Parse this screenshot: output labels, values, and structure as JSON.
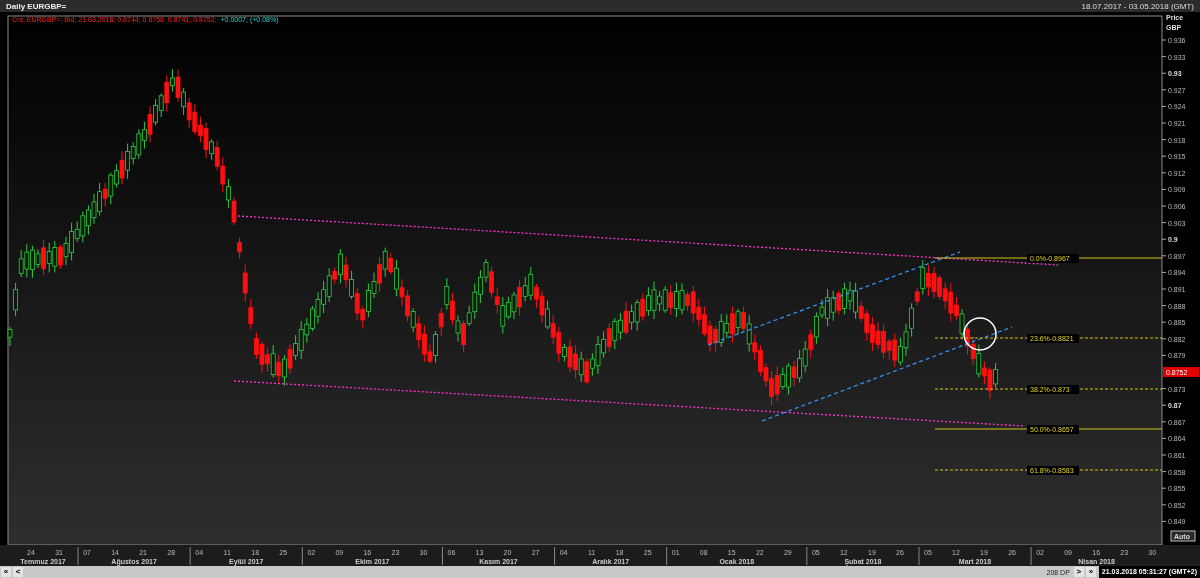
{
  "window": {
    "title": "Daily EURGBP=",
    "date_range": "18.07.2017 - 03.05.2018 (GMT)"
  },
  "quote": {
    "instrument": "Cnt; EURGBP=; Bid; 21.03.2018; 0.8744; 0.8758; 0.8741; 0.8752;",
    "change": "+0.0007; (+0.08%)"
  },
  "price_axis": {
    "title": "Price",
    "currency": "GBP",
    "ticks_upper": [
      {
        "label": "0.936",
        "bold": false
      },
      {
        "label": "0.933",
        "bold": false
      },
      {
        "label": "0.93",
        "bold": true
      },
      {
        "label": "0.927",
        "bold": false
      },
      {
        "label": "0.924",
        "bold": false
      },
      {
        "label": "0.921",
        "bold": false
      },
      {
        "label": "0.918",
        "bold": false
      },
      {
        "label": "0.915",
        "bold": false
      },
      {
        "label": "0.912",
        "bold": false
      },
      {
        "label": "0.909",
        "bold": false
      },
      {
        "label": "0.906",
        "bold": false
      },
      {
        "label": "0.903",
        "bold": false
      },
      {
        "label": "0.9",
        "bold": true
      },
      {
        "label": "0.897",
        "bold": false
      },
      {
        "label": "0.894",
        "bold": false
      },
      {
        "label": "0.891",
        "bold": false
      },
      {
        "label": "0.888",
        "bold": false
      },
      {
        "label": "0.885",
        "bold": false
      },
      {
        "label": "0.882",
        "bold": false
      },
      {
        "label": "0.879",
        "bold": false
      }
    ],
    "ticks_lower": [
      {
        "label": "0.873",
        "bold": false
      },
      {
        "label": "0.87",
        "bold": true
      },
      {
        "label": "0.867",
        "bold": false
      },
      {
        "label": "0.864",
        "bold": false
      },
      {
        "label": "0.861",
        "bold": false
      },
      {
        "label": "0.858",
        "bold": false
      },
      {
        "label": "0.855",
        "bold": false
      },
      {
        "label": "0.852",
        "bold": false
      },
      {
        "label": "0.849",
        "bold": false
      }
    ],
    "current_price": "0.8752",
    "auto_button": "Auto"
  },
  "fibonacci": [
    {
      "label": "0.0%-0.8967",
      "kind": "solid"
    },
    {
      "label": "23.6%-0.8821",
      "kind": "dashed"
    },
    {
      "label": "38.2%-0.873",
      "kind": "dashed"
    },
    {
      "label": "50.0%-0.8657",
      "kind": "solid"
    },
    {
      "label": "61.8%-0.8583",
      "kind": "dashed"
    }
  ],
  "time_axis": {
    "months": [
      {
        "label": "Temmuz 2017",
        "days": [
          "24",
          "31"
        ]
      },
      {
        "label": "Ağustos 2017",
        "days": [
          "07",
          "14",
          "21",
          "28"
        ]
      },
      {
        "label": "Eylül 2017",
        "days": [
          "04",
          "11",
          "18",
          "25"
        ]
      },
      {
        "label": "Ekim 2017",
        "days": [
          "02",
          "09",
          "16",
          "23",
          "30"
        ]
      },
      {
        "label": "Kasım 2017",
        "days": [
          "06",
          "13",
          "20",
          "27"
        ]
      },
      {
        "label": "Aralık 2017",
        "days": [
          "04",
          "11",
          "18",
          "25"
        ]
      },
      {
        "label": "Ocak 2018",
        "days": [
          "01",
          "08",
          "15",
          "22",
          "29"
        ]
      },
      {
        "label": "Şubat 2018",
        "days": [
          "05",
          "12",
          "19",
          "26"
        ]
      },
      {
        "label": "Mart 2018",
        "days": [
          "05",
          "12",
          "19",
          "26"
        ]
      },
      {
        "label": "Nisan 2018",
        "days": [
          "02",
          "09",
          "16",
          "23",
          "30"
        ]
      }
    ]
  },
  "scrollbar": {
    "first": "«",
    "prev": "<",
    "points": "208 DP",
    "next": ">",
    "last": "»",
    "timestamp": "21.03.2018 05:31:27 (GMT+2)"
  }
}
